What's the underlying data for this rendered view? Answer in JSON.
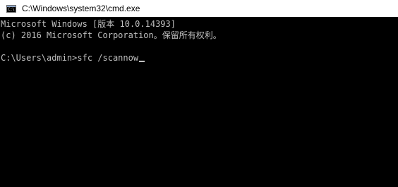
{
  "window": {
    "title": "C:\\Windows\\system32\\cmd.exe",
    "icon": "cmd-icon"
  },
  "console": {
    "lines": [
      "Microsoft Windows [版本 10.0.14393]",
      "(c) 2016 Microsoft Corporation。保留所有权利。",
      "",
      ""
    ],
    "prompt": "C:\\Users\\admin>",
    "command": "sfc /scannow"
  },
  "colors": {
    "background": "#000000",
    "text": "#c0c0c0",
    "titlebar": "#ffffff"
  }
}
